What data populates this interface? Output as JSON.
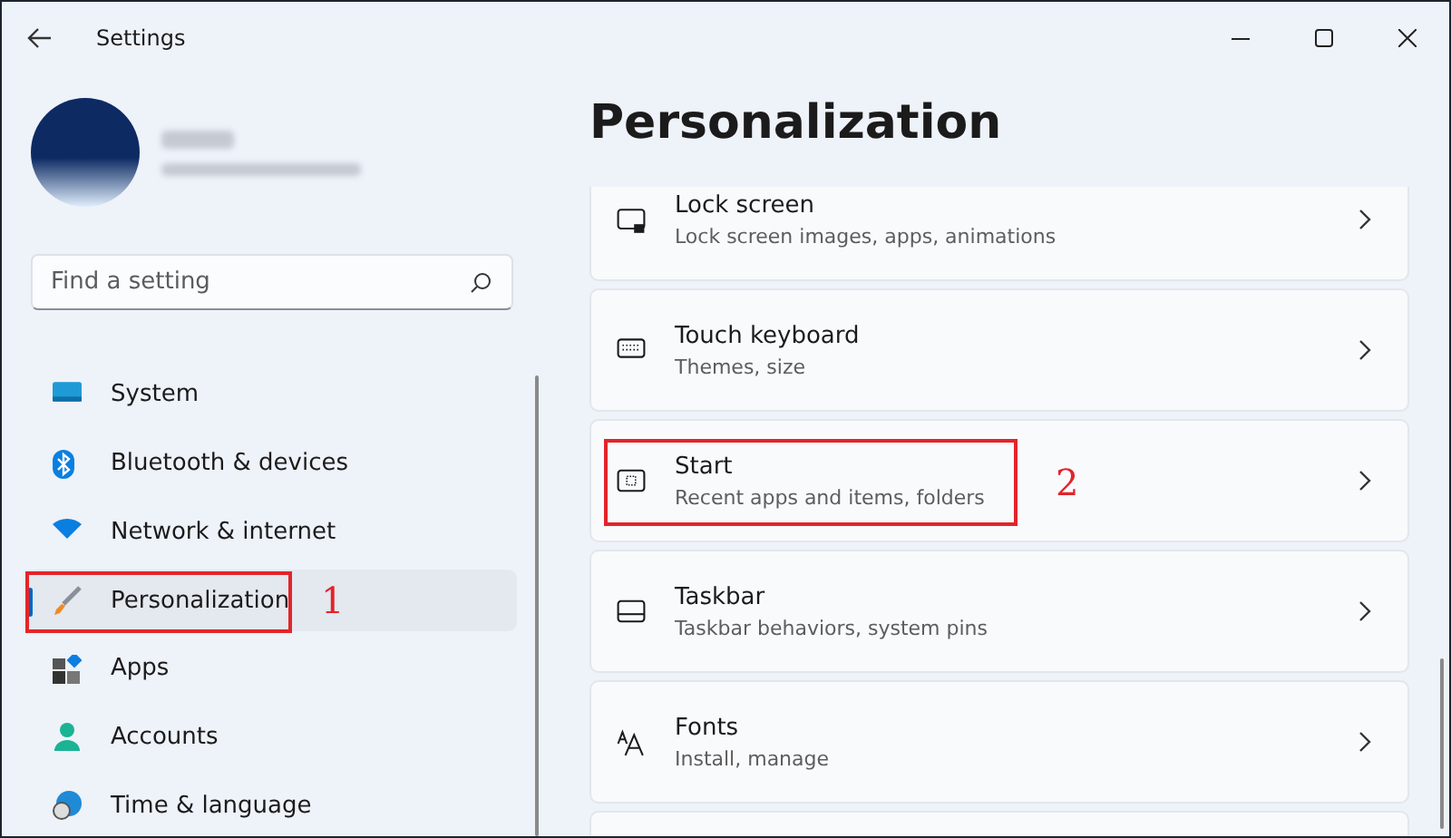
{
  "window": {
    "title": "Settings"
  },
  "search": {
    "placeholder": "Find a setting"
  },
  "sidebar": {
    "items": [
      {
        "label": "System",
        "selected": false
      },
      {
        "label": "Bluetooth & devices",
        "selected": false
      },
      {
        "label": "Network & internet",
        "selected": false
      },
      {
        "label": "Personalization",
        "selected": true,
        "callout": "1"
      },
      {
        "label": "Apps",
        "selected": false
      },
      {
        "label": "Accounts",
        "selected": false
      },
      {
        "label": "Time & language",
        "selected": false
      }
    ]
  },
  "page": {
    "title": "Personalization"
  },
  "cards": [
    {
      "kind": "setting",
      "title": "Lock screen",
      "subtitle": "Lock screen images, apps, animations"
    },
    {
      "kind": "setting",
      "title": "Touch keyboard",
      "subtitle": "Themes, size"
    },
    {
      "kind": "setting",
      "title": "Start",
      "subtitle": "Recent apps and items, folders",
      "callout": "2"
    },
    {
      "kind": "setting",
      "title": "Taskbar",
      "subtitle": "Taskbar behaviors, system pins"
    },
    {
      "kind": "setting",
      "title": "Fonts",
      "subtitle": "Install, manage"
    },
    {
      "kind": "partial"
    }
  ]
}
